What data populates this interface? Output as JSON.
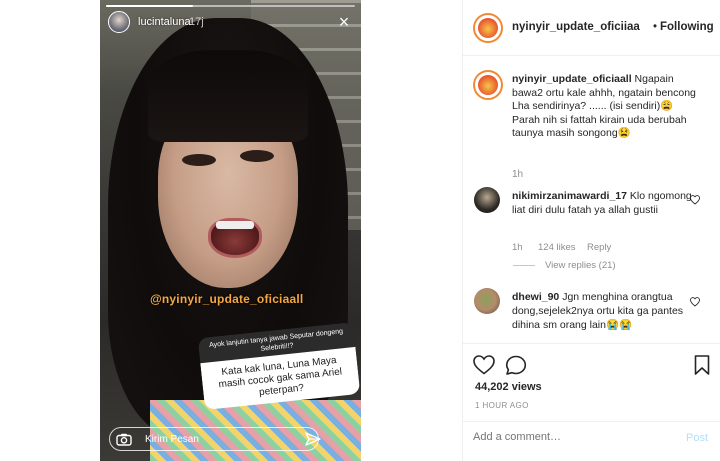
{
  "story": {
    "username": "lucintaluna",
    "time": "17j",
    "progress_fraction": 0.35,
    "watermark": "@nyinyir_update_oficiaall",
    "question_header": "Ayok lanjutin tanya jawab Seputar dongeng Selebriti!!?",
    "question_text": "Kata kak luna, Luna Maya masih cocok gak sama Ariel peterpan?",
    "reply_placeholder": "Kirim Pesan"
  },
  "post": {
    "header": {
      "username": "nyinyir_update_oficiiaa",
      "dot": "•",
      "follow_label": "Following"
    },
    "caption": {
      "username": "nyinyir_update_oficiaall",
      "text_line1": " Ngapain bawa2 ortu kale ahhh, ngatain bencong",
      "text_line2": "Lha sendirinya? ...... (isi sendiri)😩",
      "text_line3": "Parah nih si fattah kirain uda berubah taunya masih songong😫",
      "time": "1h"
    },
    "comments": [
      {
        "username": "nikimirzanimawardi_17",
        "text": " Klo ngomong liat diri dulu fatah ya allah gustii",
        "time": "1h",
        "likes": "124 likes",
        "reply_label": "Reply",
        "view_replies": "View replies (21)"
      },
      {
        "username": "dhewi_90",
        "text": " Jgn menghina orangtua dong,sejelek2nya ortu kita ga pantes dihina sm orang lain😭😭"
      }
    ],
    "views": "44,202 views",
    "time_ago": "1 HOUR AGO",
    "comment_placeholder": "Add a comment…",
    "post_label": "Post"
  },
  "colors": {
    "text": "#262626",
    "secondary": "#8e8e8e",
    "post_disabled": "#b2dffc",
    "avatar_ring": "#f08a34",
    "watermark": "#f5a742"
  },
  "icons": [
    "close-icon",
    "camera-icon",
    "send-icon",
    "heart-icon",
    "comment-icon",
    "bookmark-icon"
  ]
}
